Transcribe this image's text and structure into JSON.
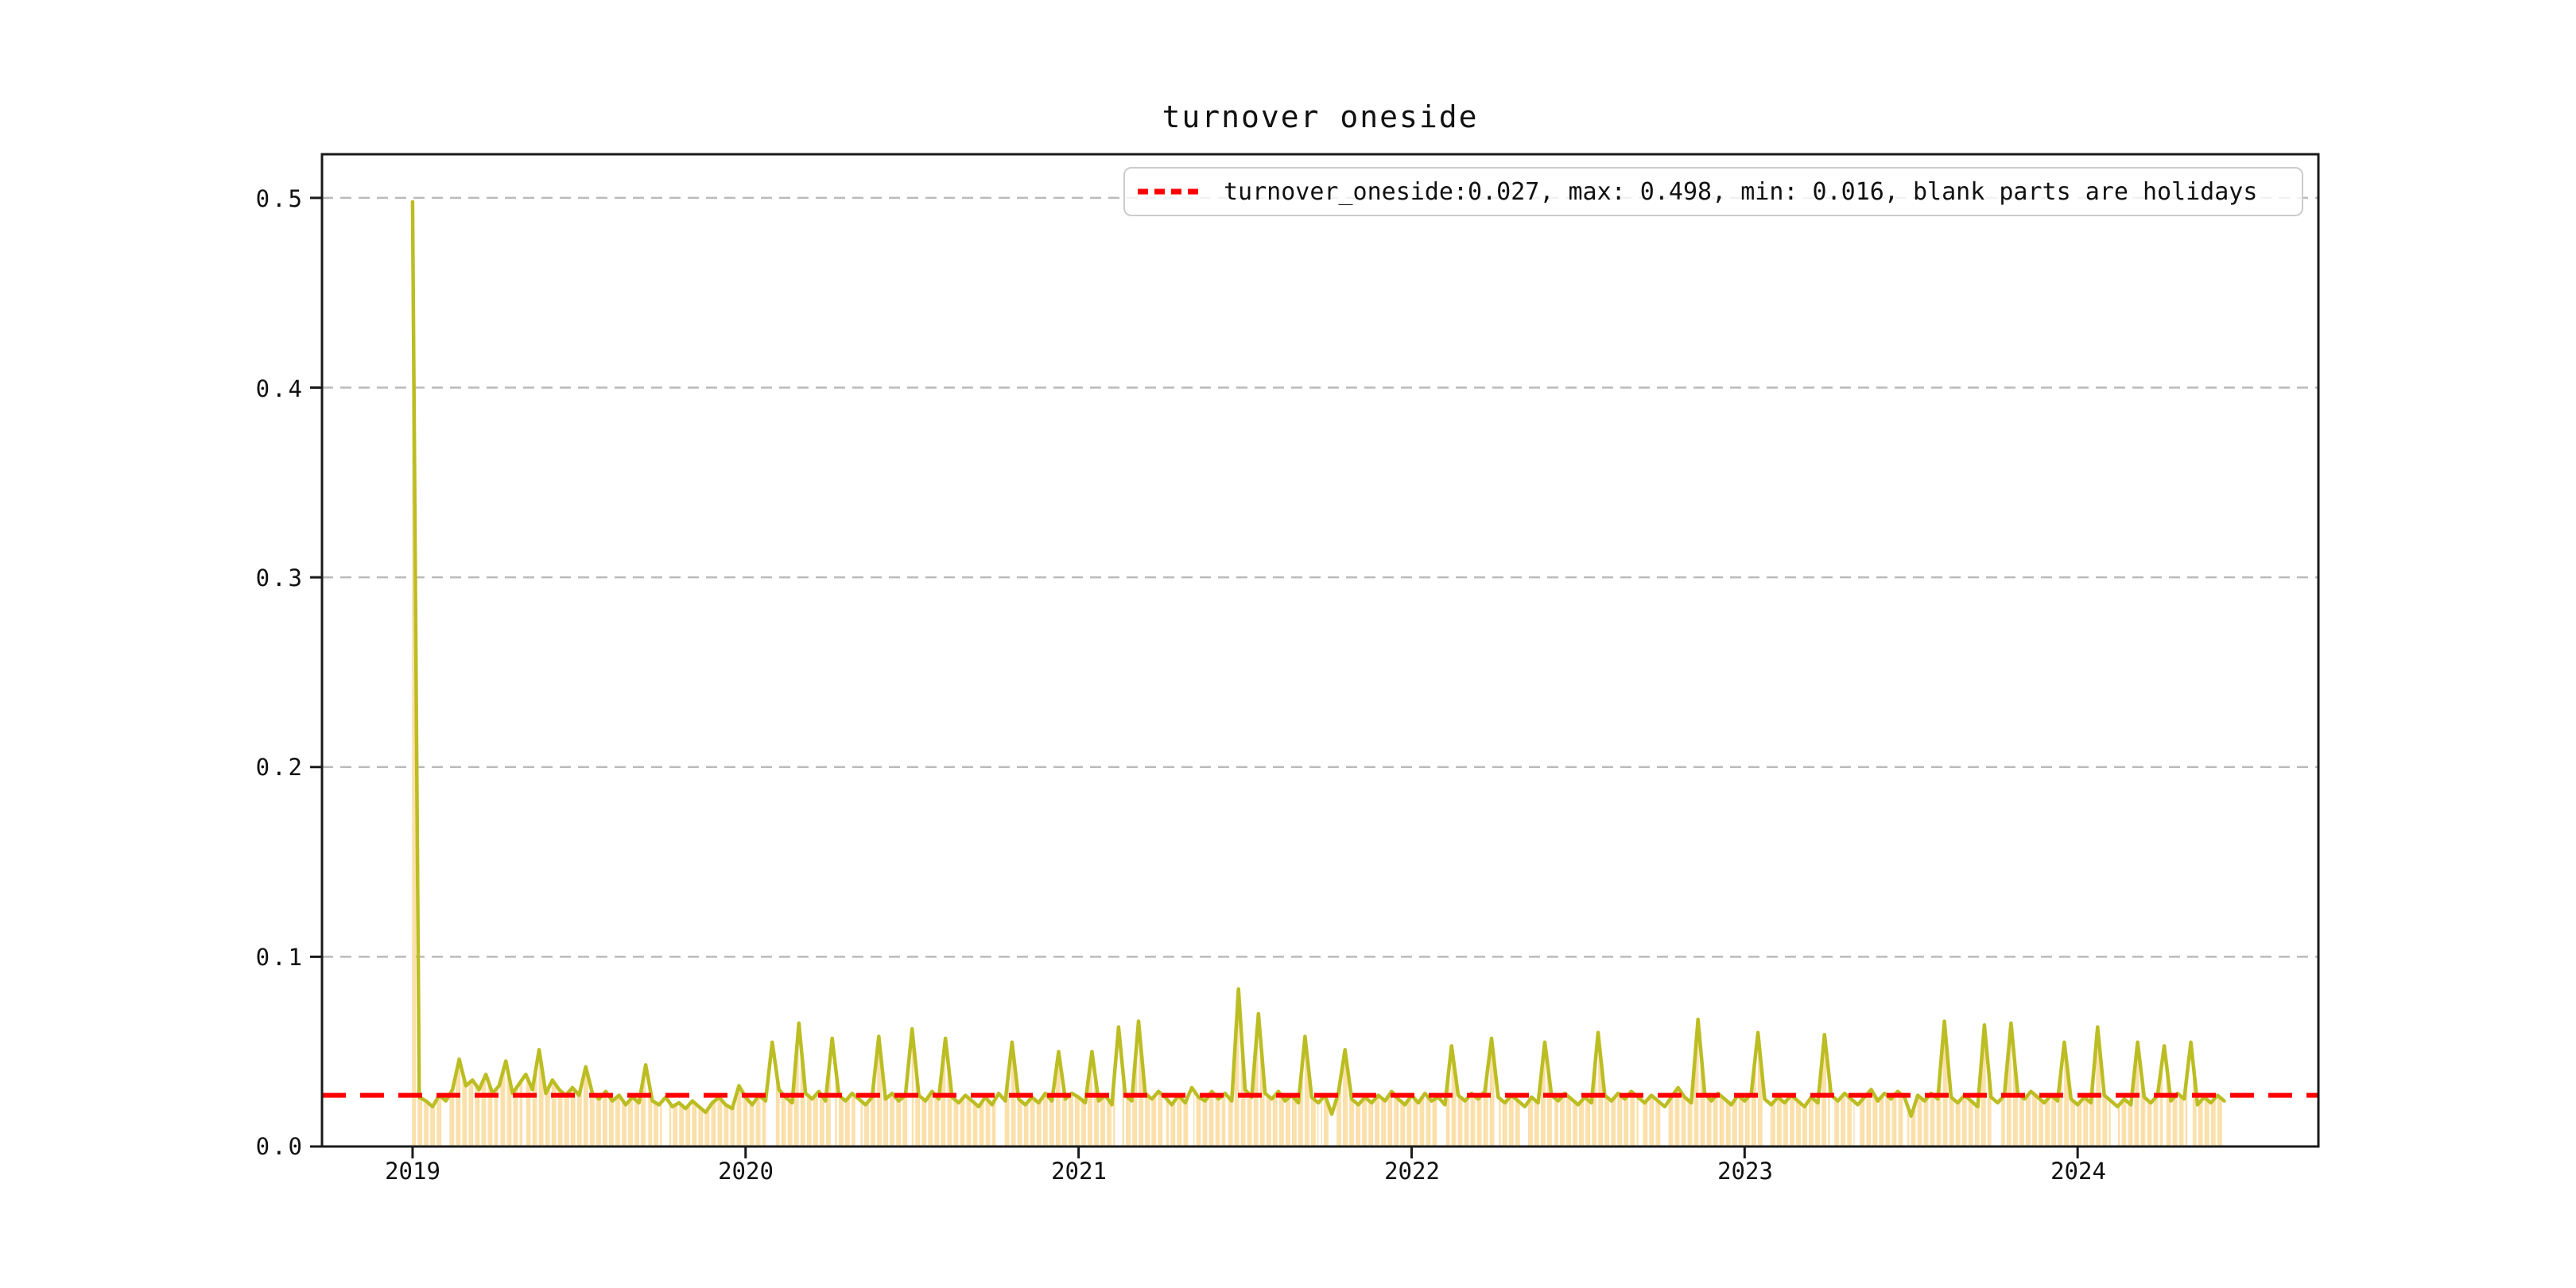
{
  "title": "turnover oneside",
  "legend": {
    "label": "turnover_oneside:0.027, max: 0.498, min: 0.016, blank parts are holidays",
    "marker_color": "#ff0000"
  },
  "chart_data": {
    "type": "line+bar",
    "title": "turnover oneside",
    "series_name": "turnover_oneside",
    "mean": 0.027,
    "max": 0.498,
    "min": 0.016,
    "x_start": 2019.0,
    "x_step": 0.02,
    "x_end": 2024.44,
    "xlim": [
      2018.728,
      2024.723
    ],
    "ylim": [
      0,
      0.523
    ],
    "yticks": [
      0.0,
      0.1,
      0.2,
      0.3,
      0.4,
      0.5
    ],
    "ytick_labels": [
      "0.0",
      "0.1",
      "0.2",
      "0.3",
      "0.4",
      "0.5"
    ],
    "xticks": [
      2019,
      2020,
      2021,
      2022,
      2023,
      2024
    ],
    "xtick_labels": [
      "2019",
      "2020",
      "2021",
      "2022",
      "2023",
      "2024"
    ],
    "grid": true,
    "legend_position": "upper right",
    "line_color": "#bcbd22",
    "bar_color": "#fbdfa8",
    "mean_color": "#ff0000",
    "grid_color": "#bbbbbb",
    "axis_color": "#1a1a1a",
    "values": [
      0.498,
      0.026,
      0.024,
      0.021,
      0.027,
      0.024,
      0.03,
      0.046,
      0.032,
      0.035,
      0.03,
      0.038,
      0.028,
      0.032,
      0.045,
      0.028,
      0.033,
      0.038,
      0.03,
      0.051,
      0.028,
      0.035,
      0.03,
      0.027,
      0.031,
      0.027,
      0.042,
      0.028,
      0.025,
      0.029,
      0.024,
      0.027,
      0.022,
      0.026,
      0.023,
      0.043,
      0.024,
      0.022,
      0.026,
      0.021,
      0.023,
      0.02,
      0.024,
      0.021,
      0.018,
      0.023,
      0.026,
      0.022,
      0.02,
      0.032,
      0.026,
      0.022,
      0.027,
      0.024,
      0.055,
      0.03,
      0.026,
      0.023,
      0.065,
      0.028,
      0.025,
      0.029,
      0.024,
      0.057,
      0.027,
      0.024,
      0.028,
      0.025,
      0.022,
      0.026,
      0.058,
      0.025,
      0.028,
      0.024,
      0.027,
      0.062,
      0.027,
      0.024,
      0.029,
      0.025,
      0.057,
      0.026,
      0.023,
      0.027,
      0.024,
      0.021,
      0.026,
      0.022,
      0.028,
      0.024,
      0.055,
      0.025,
      0.022,
      0.026,
      0.023,
      0.028,
      0.024,
      0.05,
      0.025,
      0.028,
      0.026,
      0.023,
      0.05,
      0.024,
      0.027,
      0.022,
      0.063,
      0.027,
      0.024,
      0.066,
      0.028,
      0.025,
      0.029,
      0.026,
      0.022,
      0.027,
      0.023,
      0.031,
      0.026,
      0.024,
      0.029,
      0.025,
      0.028,
      0.024,
      0.083,
      0.03,
      0.026,
      0.07,
      0.028,
      0.025,
      0.029,
      0.024,
      0.027,
      0.023,
      0.058,
      0.026,
      0.023,
      0.027,
      0.017,
      0.028,
      0.051,
      0.025,
      0.022,
      0.026,
      0.023,
      0.027,
      0.024,
      0.029,
      0.025,
      0.022,
      0.027,
      0.023,
      0.028,
      0.024,
      0.026,
      0.022,
      0.053,
      0.027,
      0.024,
      0.028,
      0.025,
      0.029,
      0.057,
      0.026,
      0.023,
      0.027,
      0.024,
      0.021,
      0.026,
      0.023,
      0.055,
      0.027,
      0.024,
      0.028,
      0.025,
      0.022,
      0.026,
      0.023,
      0.06,
      0.027,
      0.024,
      0.028,
      0.025,
      0.029,
      0.026,
      0.023,
      0.027,
      0.024,
      0.021,
      0.026,
      0.031,
      0.026,
      0.023,
      0.067,
      0.028,
      0.024,
      0.028,
      0.025,
      0.022,
      0.027,
      0.024,
      0.028,
      0.06,
      0.025,
      0.022,
      0.026,
      0.023,
      0.027,
      0.024,
      0.021,
      0.026,
      0.023,
      0.059,
      0.027,
      0.024,
      0.028,
      0.025,
      0.022,
      0.026,
      0.03,
      0.024,
      0.028,
      0.025,
      0.029,
      0.026,
      0.016,
      0.027,
      0.024,
      0.028,
      0.025,
      0.066,
      0.026,
      0.023,
      0.027,
      0.024,
      0.021,
      0.064,
      0.026,
      0.023,
      0.027,
      0.065,
      0.028,
      0.025,
      0.029,
      0.026,
      0.023,
      0.027,
      0.024,
      0.055,
      0.025,
      0.022,
      0.026,
      0.023,
      0.063,
      0.027,
      0.024,
      0.021,
      0.025,
      0.022,
      0.055,
      0.026,
      0.023,
      0.027,
      0.053,
      0.024,
      0.028,
      0.025,
      0.055,
      0.022,
      0.026,
      0.023,
      0.027,
      0.024
    ],
    "holiday_gaps": [
      [
        2019.085,
        2019.105
      ],
      [
        2019.255,
        2019.263
      ],
      [
        2019.33,
        2019.341
      ],
      [
        2019.43,
        2019.438
      ],
      [
        2019.7,
        2019.708
      ],
      [
        2019.75,
        2019.77
      ],
      [
        2020.06,
        2020.092
      ],
      [
        2020.26,
        2020.268
      ],
      [
        2020.33,
        2020.346
      ],
      [
        2020.49,
        2020.498
      ],
      [
        2020.75,
        2020.774
      ],
      [
        2021.11,
        2021.132
      ],
      [
        2021.255,
        2021.263
      ],
      [
        2021.33,
        2021.346
      ],
      [
        2021.44,
        2021.448
      ],
      [
        2021.72,
        2021.728
      ],
      [
        2021.75,
        2021.77
      ],
      [
        2022.08,
        2022.102
      ],
      [
        2022.255,
        2022.263
      ],
      [
        2022.33,
        2022.346
      ],
      [
        2022.42,
        2022.428
      ],
      [
        2022.68,
        2022.688
      ],
      [
        2022.75,
        2022.77
      ],
      [
        2023.055,
        2023.077
      ],
      [
        2023.255,
        2023.263
      ],
      [
        2023.33,
        2023.346
      ],
      [
        2023.48,
        2023.488
      ],
      [
        2023.74,
        2023.77
      ],
      [
        2024.1,
        2024.122
      ],
      [
        2024.255,
        2024.263
      ],
      [
        2024.33,
        2024.346
      ]
    ]
  }
}
